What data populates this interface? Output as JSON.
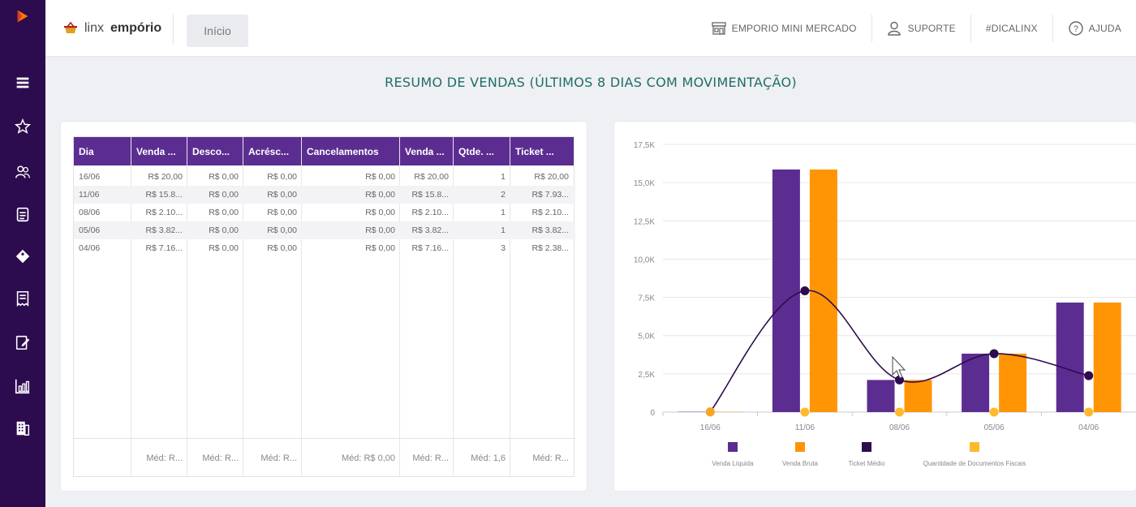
{
  "sidebar": {
    "items": [
      {
        "icon": "logo-icon"
      },
      {
        "icon": "menu-icon"
      },
      {
        "icon": "star-icon"
      },
      {
        "icon": "users-icon"
      },
      {
        "icon": "clipboard-icon"
      },
      {
        "icon": "tag-icon"
      },
      {
        "icon": "receipt-icon"
      },
      {
        "icon": "edit-document-icon"
      },
      {
        "icon": "bar-chart-icon"
      },
      {
        "icon": "buildings-icon"
      }
    ]
  },
  "header": {
    "brand_light": "linx",
    "brand_bold": "empório",
    "home_tab": "Início",
    "links": [
      {
        "label": "EMPORIO MINI MERCADO",
        "icon": "store-icon"
      },
      {
        "label": "SUPORTE",
        "icon": "person-icon"
      },
      {
        "label": "#DICALINX",
        "icon": ""
      },
      {
        "label": "AJUDA",
        "icon": "help-icon"
      }
    ]
  },
  "page_title": "RESUMO DE VENDAS (ÚLTIMOS 8 DIAS COM MOVIMENTAÇÃO)",
  "table": {
    "columns": [
      "Dia",
      "Venda ...",
      "Desco...",
      "Acrésc...",
      "Cancelamentos",
      "Venda ...",
      "Qtde. ...",
      "Ticket ..."
    ],
    "rows": [
      [
        "16/06",
        "R$ 20,00",
        "R$ 0,00",
        "R$ 0,00",
        "R$ 0,00",
        "R$ 20,00",
        "1",
        "R$ 20,00"
      ],
      [
        "11/06",
        "R$ 15.8...",
        "R$ 0,00",
        "R$ 0,00",
        "R$ 0,00",
        "R$ 15.8...",
        "2",
        "R$ 7.93..."
      ],
      [
        "08/06",
        "R$ 2.10...",
        "R$ 0,00",
        "R$ 0,00",
        "R$ 0,00",
        "R$ 2.10...",
        "1",
        "R$ 2.10..."
      ],
      [
        "05/06",
        "R$ 3.82...",
        "R$ 0,00",
        "R$ 0,00",
        "R$ 0,00",
        "R$ 3.82...",
        "1",
        "R$ 3.82..."
      ],
      [
        "04/06",
        "R$ 7.16...",
        "R$ 0,00",
        "R$ 0,00",
        "R$ 0,00",
        "R$ 7.16...",
        "3",
        "R$ 2.38..."
      ]
    ],
    "footer": [
      "",
      "Méd: R...",
      "Méd: R...",
      "Méd: R...",
      "Méd: R$ 0,00",
      "Méd: R...",
      "Méd: 1,6",
      "Méd: R..."
    ]
  },
  "chart_data": {
    "type": "bar",
    "categories": [
      "16/06",
      "11/06",
      "08/06",
      "05/06",
      "04/06"
    ],
    "ylim": [
      0,
      17500
    ],
    "yticks": [
      "0",
      "2,5K",
      "5,0K",
      "7,5K",
      "10,0K",
      "12,5K",
      "15,0K",
      "17,5K"
    ],
    "series": [
      {
        "name": "Venda Líquida",
        "kind": "bar",
        "color": "#5c2d91",
        "values": [
          20,
          15860,
          2100,
          3820,
          7160
        ]
      },
      {
        "name": "Venda Bruta",
        "kind": "bar",
        "color": "#ff9505",
        "values": [
          20,
          15860,
          2100,
          3820,
          7160
        ]
      },
      {
        "name": "Ticket Médio",
        "kind": "line",
        "color": "#2d0b4f",
        "values": [
          20,
          7930,
          2100,
          3820,
          2380
        ]
      },
      {
        "name": "Quantidade de Documentos Fiscais",
        "kind": "line",
        "color": "#ffb92e",
        "values": [
          1,
          2,
          1,
          1,
          3
        ]
      }
    ],
    "grid": true,
    "legend": "bottom"
  }
}
